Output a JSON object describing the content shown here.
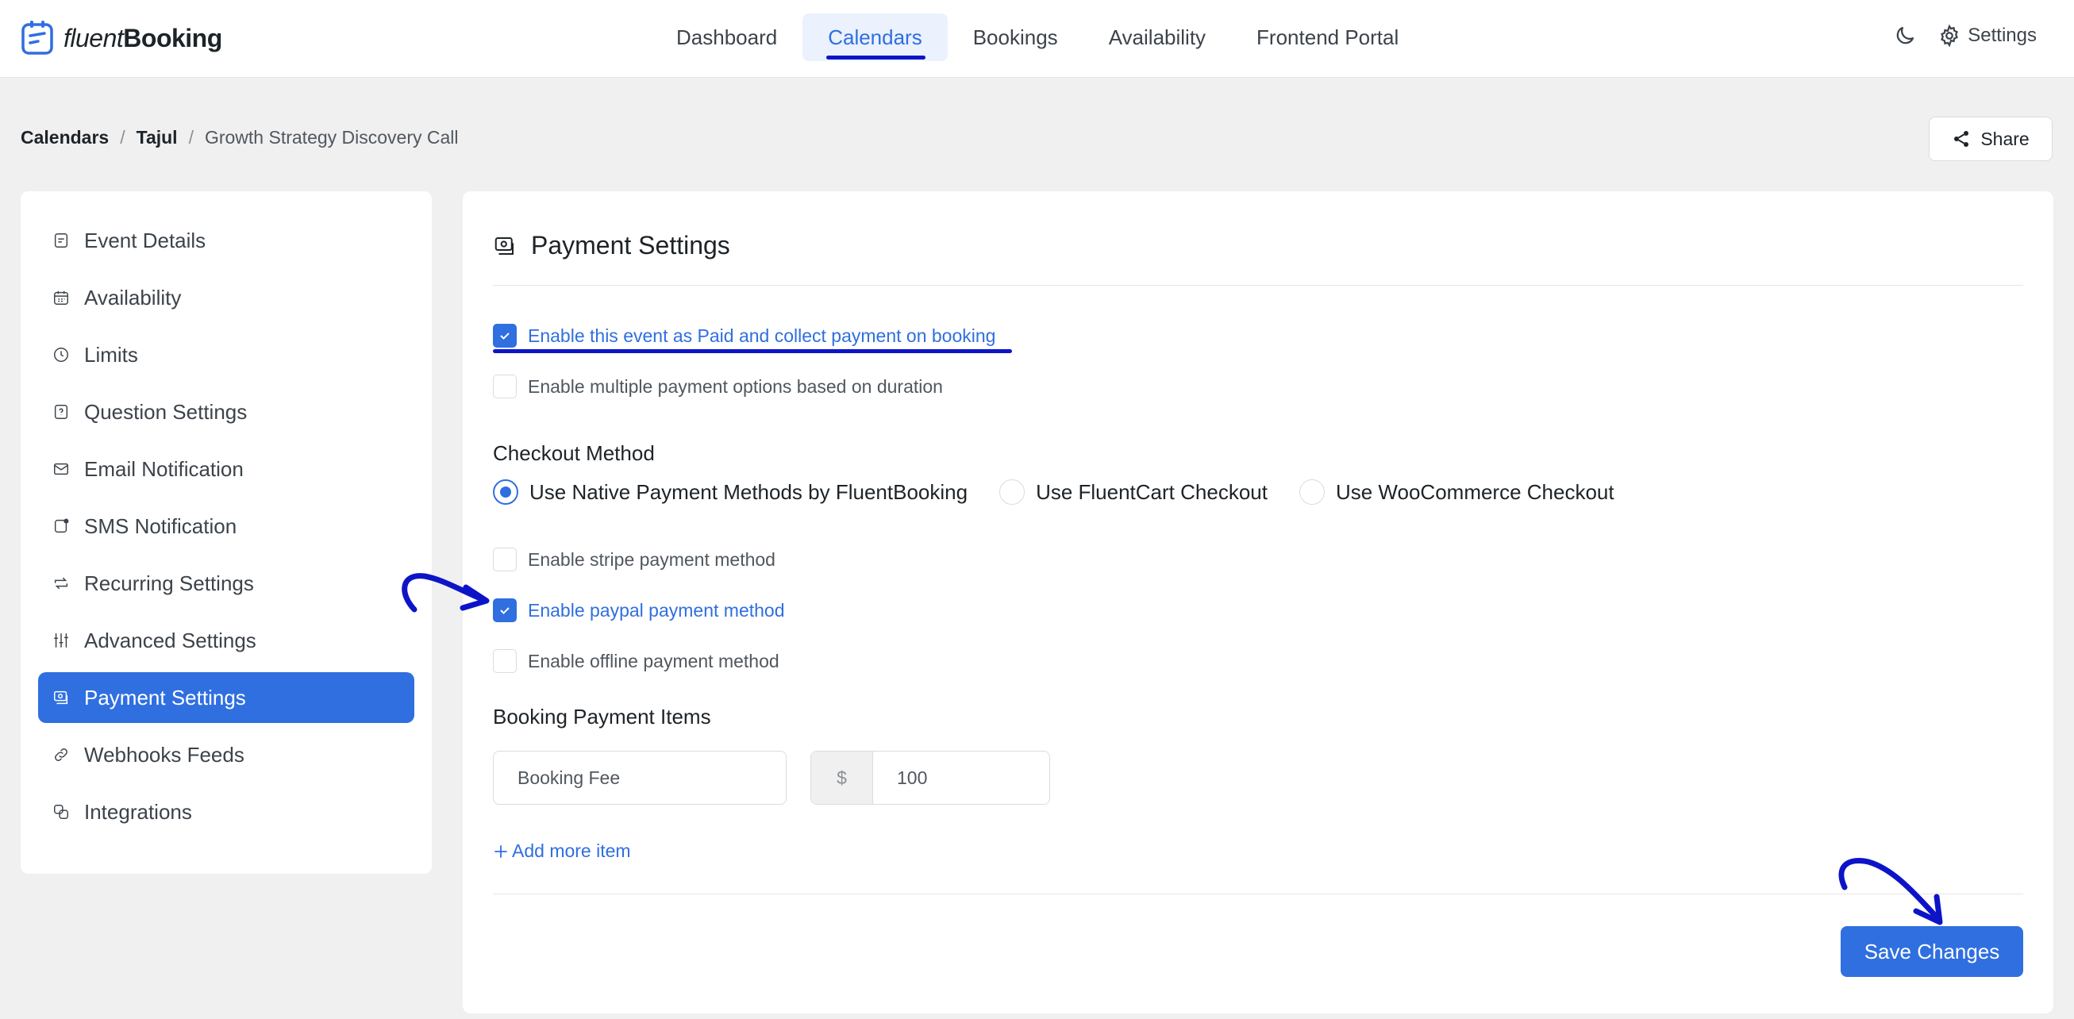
{
  "brand": {
    "name_light": "fluent",
    "name_bold": "Booking"
  },
  "nav": {
    "items": [
      {
        "label": "Dashboard"
      },
      {
        "label": "Calendars"
      },
      {
        "label": "Bookings"
      },
      {
        "label": "Availability"
      },
      {
        "label": "Frontend Portal"
      }
    ],
    "active": "Calendars",
    "settings_label": "Settings"
  },
  "breadcrumb": {
    "first": "Calendars",
    "second": "Tajul",
    "third": "Growth Strategy Discovery Call",
    "separator": "/"
  },
  "share_label": "Share",
  "sidebar": {
    "items": [
      {
        "label": "Event Details",
        "icon": "document-icon"
      },
      {
        "label": "Availability",
        "icon": "calendar-icon"
      },
      {
        "label": "Limits",
        "icon": "clock-icon"
      },
      {
        "label": "Question Settings",
        "icon": "question-icon"
      },
      {
        "label": "Email Notification",
        "icon": "mail-icon"
      },
      {
        "label": "SMS Notification",
        "icon": "sms-icon"
      },
      {
        "label": "Recurring Settings",
        "icon": "recurring-icon"
      },
      {
        "label": "Advanced Settings",
        "icon": "sliders-icon"
      },
      {
        "label": "Payment Settings",
        "icon": "payment-icon"
      },
      {
        "label": "Webhooks Feeds",
        "icon": "link-icon"
      },
      {
        "label": "Integrations",
        "icon": "integrations-icon"
      }
    ],
    "active": "Payment Settings"
  },
  "main": {
    "title": "Payment Settings",
    "enable_paid": {
      "label": "Enable this event as Paid and collect payment on booking",
      "checked": true
    },
    "enable_multiple": {
      "label": "Enable multiple payment options based on duration",
      "checked": false
    },
    "checkout_method": {
      "label": "Checkout Method",
      "options": [
        {
          "label": "Use Native Payment Methods by FluentBooking",
          "selected": true
        },
        {
          "label": "Use FluentCart Checkout",
          "selected": false
        },
        {
          "label": "Use WooCommerce Checkout",
          "selected": false
        }
      ]
    },
    "methods": {
      "stripe": {
        "label": "Enable stripe payment method",
        "checked": false
      },
      "paypal": {
        "label": "Enable paypal payment method",
        "checked": true
      },
      "offline": {
        "label": "Enable offline payment method",
        "checked": false
      }
    },
    "items_label": "Booking Payment Items",
    "item": {
      "name": "Booking Fee",
      "currency": "$",
      "amount": "100"
    },
    "add_more_label": "Add more item",
    "save_label": "Save Changes"
  },
  "colors": {
    "accent": "#2f6fe0",
    "annotation": "#0d14c8",
    "background": "#f0f0f1"
  }
}
